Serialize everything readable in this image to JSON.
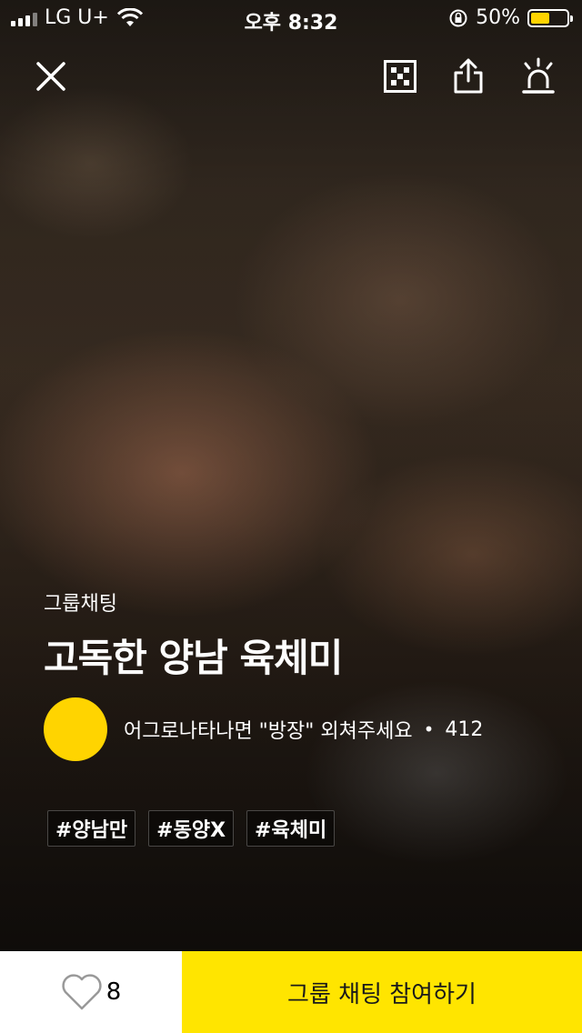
{
  "status_bar": {
    "carrier": "LG U+",
    "time": "오후 8:32",
    "battery": "50%",
    "battery_level": 0.5
  },
  "topbar": {
    "close_icon": "close-icon",
    "qr_icon": "qr-code-icon",
    "share_icon": "share-icon",
    "report_icon": "siren-icon"
  },
  "room": {
    "type_label": "그룹채팅",
    "title": "고독한 양남 육체미",
    "description": "어그로나타나면 \"방장\" 외쳐주세요",
    "separator": "•",
    "member_count": "412",
    "tags": [
      "#양남만",
      "#동양X",
      "#육체미"
    ]
  },
  "bottom": {
    "like_count": "8",
    "join_label": "그룹 채팅 참여하기"
  },
  "colors": {
    "accent": "#ffe500",
    "avatar": "#ffd400"
  }
}
